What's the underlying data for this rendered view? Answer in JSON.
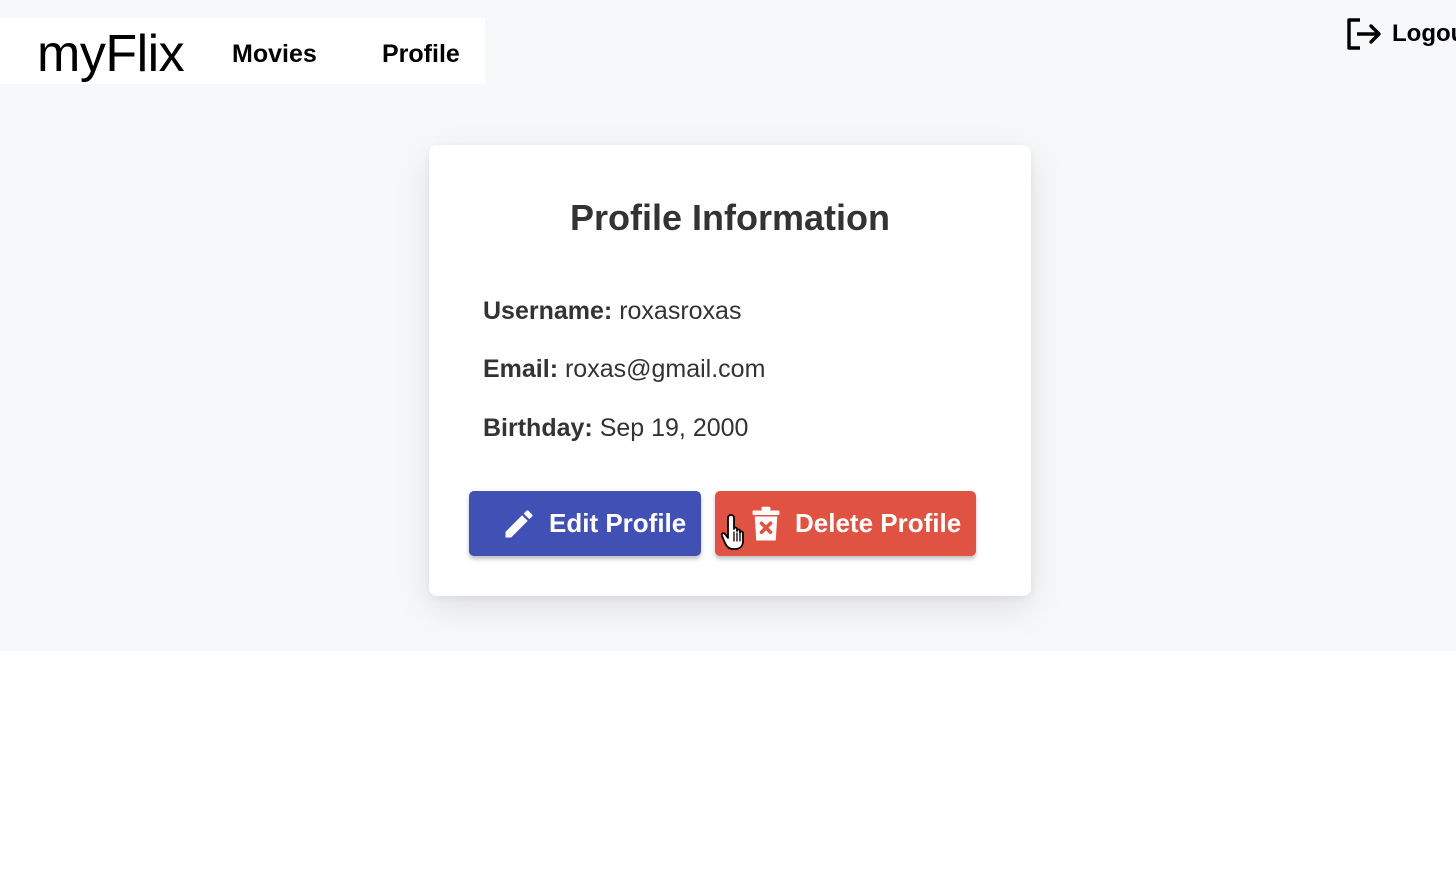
{
  "navbar": {
    "brand": "myFlix",
    "links": [
      {
        "label": "Movies"
      },
      {
        "label": "Profile"
      }
    ],
    "logout_label": "Logout"
  },
  "profile_card": {
    "title": "Profile Information",
    "fields": {
      "username": {
        "label": "Username:",
        "value": "roxasroxas"
      },
      "email": {
        "label": "Email:",
        "value": "roxas@gmail.com"
      },
      "birthday": {
        "label": "Birthday:",
        "value": "Sep 19, 2000"
      }
    },
    "buttons": {
      "edit_label": "Edit Profile",
      "delete_label": "Delete Profile"
    }
  },
  "icons": {
    "logout": "logout-icon",
    "edit": "pencil-icon",
    "delete": "trash-x-icon",
    "cursor": "hand-pointer-cursor"
  },
  "colors": {
    "edit_button": "#4150b5",
    "delete_button": "#e05241",
    "background": "#f7f8fa",
    "text": "#333333"
  }
}
